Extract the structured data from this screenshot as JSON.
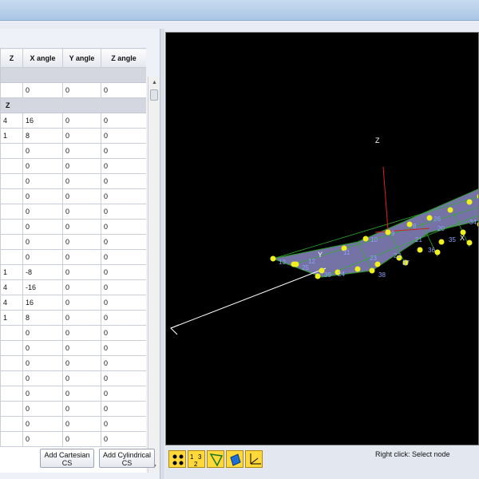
{
  "table": {
    "headers": [
      "Z",
      "X angle",
      "Y angle",
      "Z angle"
    ],
    "group1_rows": [
      [
        "",
        "0",
        "0",
        "0"
      ]
    ],
    "group2_label": "Z",
    "group2_rows": [
      [
        "4",
        "16",
        "0",
        "0"
      ],
      [
        "1",
        "8",
        "0",
        "0"
      ],
      [
        "",
        "0",
        "0",
        "0"
      ],
      [
        "",
        "0",
        "0",
        "0"
      ],
      [
        "",
        "0",
        "0",
        "0"
      ],
      [
        "",
        "0",
        "0",
        "0"
      ],
      [
        "",
        "0",
        "0",
        "0"
      ],
      [
        "",
        "0",
        "0",
        "0"
      ],
      [
        "",
        "0",
        "0",
        "0"
      ],
      [
        "",
        "0",
        "0",
        "0"
      ],
      [
        "1",
        "-8",
        "0",
        "0"
      ],
      [
        "4",
        "-16",
        "0",
        "0"
      ],
      [
        "4",
        "16",
        "0",
        "0"
      ],
      [
        "1",
        "8",
        "0",
        "0"
      ],
      [
        "",
        "0",
        "0",
        "0"
      ],
      [
        "",
        "0",
        "0",
        "0"
      ],
      [
        "",
        "0",
        "0",
        "0"
      ],
      [
        "",
        "0",
        "0",
        "0"
      ],
      [
        "",
        "0",
        "0",
        "0"
      ],
      [
        "",
        "0",
        "0",
        "0"
      ],
      [
        "",
        "0",
        "0",
        "0"
      ],
      [
        "",
        "0",
        "0",
        "0"
      ]
    ]
  },
  "buttons": {
    "add_cartesian": "Add Cartesian CS",
    "add_cylindrical": "Add Cylindrical CS"
  },
  "viewport": {
    "axis_z_label": "Z",
    "axis_y_label": "Y",
    "axis_x_label": "X",
    "node_labels": [
      "13",
      "12",
      "11",
      "10",
      "9",
      "8",
      "26",
      "25",
      "24",
      "23",
      "22",
      "21",
      "20",
      "39",
      "38",
      "37",
      "36",
      "35",
      "34"
    ]
  },
  "toolbar": {
    "icons": [
      "node-dots-icon",
      "node-numbering-icon",
      "element-wireframe-icon",
      "shaded-element-icon",
      "axes-triad-icon"
    ]
  },
  "status": {
    "text": "Right click: Select node"
  }
}
